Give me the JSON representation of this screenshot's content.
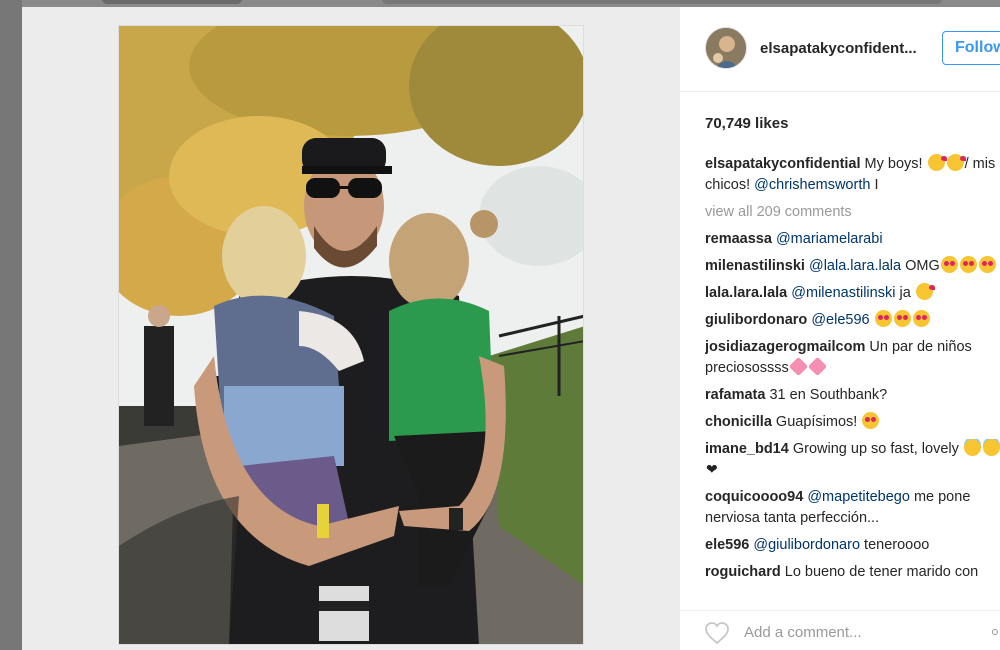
{
  "post": {
    "username": "elsapatakyconfident...",
    "follow_label": "Follow",
    "likes": "70,749 likes",
    "caption_user": "elsapatakyconfidential",
    "caption_text": " My boys! ",
    "caption_text2": "/ mis chicos! ",
    "caption_mention": "@chrishemsworth",
    "caption_tail": " I",
    "view_all": "view all 209 comments",
    "add_comment_placeholder": "Add a comment..."
  },
  "comments": [
    {
      "user": "remaassa",
      "mention": "@mariamelarabi",
      "text": ""
    },
    {
      "user": "milenastilinski",
      "mention": "@lala.lara.lala",
      "text": " OMG"
    },
    {
      "user": "lala.lara.lala",
      "mention": "@milenastilinski",
      "text": " ja "
    },
    {
      "user": "giulibordonaro",
      "mention": "@ele596",
      "text": " "
    },
    {
      "user": "josidiazagerogmailcom",
      "mention": "",
      "text": " Un par de niños preciosossss"
    },
    {
      "user": "rafamata",
      "mention": "",
      "text": " 31 en Southbank?"
    },
    {
      "user": "chonicilla",
      "mention": "",
      "text": " Guapísimos! "
    },
    {
      "user": "imane_bd14",
      "mention": "",
      "text": " Growing up so fast, lovely "
    },
    {
      "user": "coquicoooo94",
      "mention": "@mapetitebego",
      "text": " me pone nerviosa tanta perfección..."
    },
    {
      "user": "ele596",
      "mention": "@giulibordonaro",
      "text": " teneroooo"
    },
    {
      "user": "roguichard",
      "mention": "",
      "text": " Lo bueno de tener marido con"
    }
  ],
  "colors": {
    "accent": "#3897f0",
    "mention": "#003569",
    "muted": "#999999"
  },
  "icons": {
    "like": "heart-outline-icon",
    "more": "more-options-icon"
  }
}
